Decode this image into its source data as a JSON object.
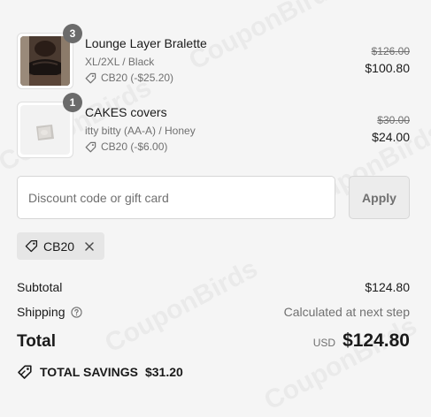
{
  "items": [
    {
      "quantity": "3",
      "name": "Lounge Layer Bralette",
      "variant": "XL/2XL / Black",
      "discount": "CB20 (-$25.20)",
      "original_price": "$126.00",
      "price": "$100.80"
    },
    {
      "quantity": "1",
      "name": "CAKES covers",
      "variant": "itty bitty (AA-A) / Honey",
      "discount": "CB20 (-$6.00)",
      "original_price": "$30.00",
      "price": "$24.00"
    }
  ],
  "discount_field": {
    "placeholder": "Discount code or gift card",
    "value": ""
  },
  "apply_label": "Apply",
  "applied_code": "CB20",
  "summary": {
    "subtotal_label": "Subtotal",
    "subtotal_value": "$124.80",
    "shipping_label": "Shipping",
    "shipping_value": "Calculated at next step",
    "total_label": "Total",
    "currency": "USD",
    "total_value": "$124.80"
  },
  "savings": {
    "label": "TOTAL SAVINGS",
    "value": "$31.20"
  },
  "watermark_text": "CouponBirds",
  "colors": {
    "background": "#f5f5f5",
    "text": "#1a1a1a",
    "muted": "#707070",
    "badge": "#6b6b6b"
  }
}
